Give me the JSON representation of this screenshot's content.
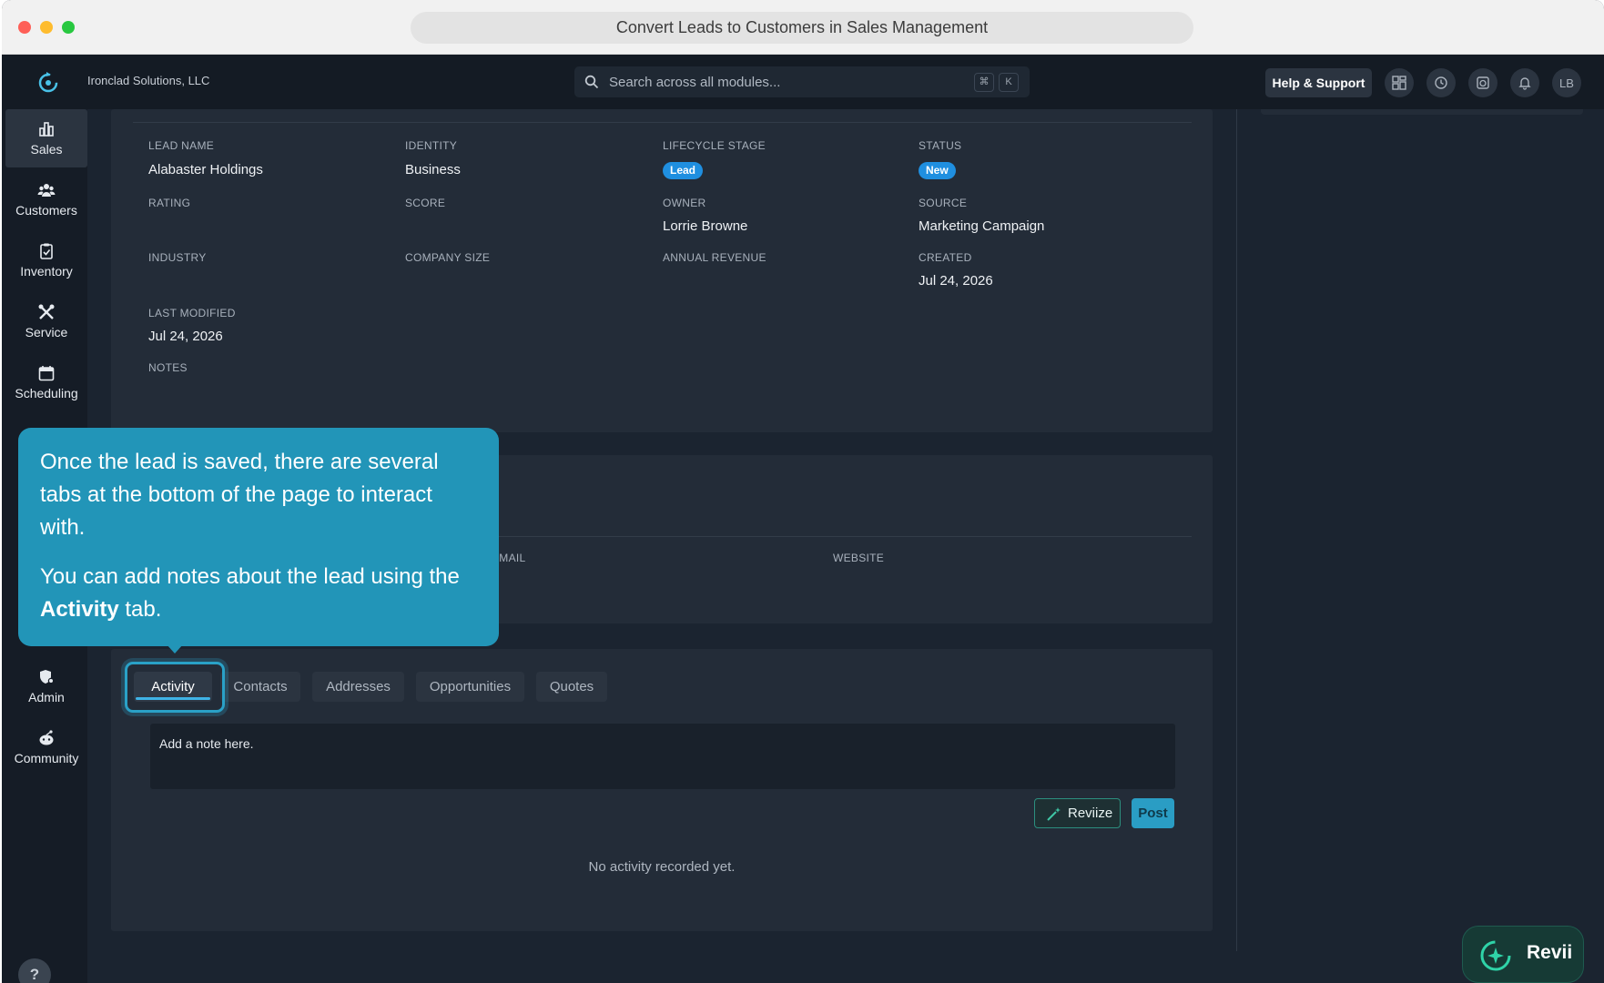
{
  "window": {
    "title": "Convert Leads to Customers in Sales Management"
  },
  "header": {
    "company": "Ironclad Solutions, LLC",
    "search_placeholder": "Search across all modules...",
    "kbd_cmd": "⌘",
    "kbd_k": "K",
    "help_label": "Help & Support",
    "avatar_initials": "LB",
    "icons": [
      "dashboard-icon",
      "history-icon",
      "timer-icon",
      "bell-icon"
    ]
  },
  "sidebar": {
    "items": [
      {
        "label": "Sales",
        "icon": "bar-chart-icon",
        "active": true
      },
      {
        "label": "Customers",
        "icon": "people-icon"
      },
      {
        "label": "Inventory",
        "icon": "clipboard-icon"
      },
      {
        "label": "Service",
        "icon": "tools-icon"
      },
      {
        "label": "Scheduling",
        "icon": "calendar-icon"
      },
      {
        "label": "Admin",
        "icon": "admin-gear-icon"
      },
      {
        "label": "Community",
        "icon": "community-icon"
      }
    ],
    "help_fab": "?"
  },
  "details": {
    "lead_name": {
      "label": "LEAD NAME",
      "value": "Alabaster Holdings"
    },
    "identity": {
      "label": "IDENTITY",
      "value": "Business"
    },
    "lifecycle_stage": {
      "label": "LIFECYCLE STAGE",
      "value": "Lead"
    },
    "status": {
      "label": "STATUS",
      "value": "New"
    },
    "rating": {
      "label": "RATING"
    },
    "score": {
      "label": "SCORE"
    },
    "owner": {
      "label": "OWNER",
      "value": "Lorrie Browne"
    },
    "source": {
      "label": "SOURCE",
      "value": "Marketing Campaign"
    },
    "industry": {
      "label": "INDUSTRY"
    },
    "company_size": {
      "label": "COMPANY SIZE"
    },
    "annual_revenue": {
      "label": "ANNUAL REVENUE"
    },
    "created": {
      "label": "CREATED",
      "value": "Jul 24, 2026"
    },
    "last_modified": {
      "label": "LAST MODIFIED",
      "value": "Jul 24, 2026"
    },
    "notes": {
      "label": "NOTES"
    }
  },
  "contact_card": {
    "email_label": "EMAIL",
    "website_label": "WEBSITE"
  },
  "tabs": [
    {
      "label": "Activity",
      "active": true
    },
    {
      "label": "Contacts"
    },
    {
      "label": "Addresses"
    },
    {
      "label": "Opportunities"
    },
    {
      "label": "Quotes"
    }
  ],
  "activity": {
    "note_text": "Add a note here.",
    "reviize_label": "Reviize",
    "post_label": "Post",
    "empty_message": "No activity recorded yet."
  },
  "tooltip": {
    "line1": "Once the lead is saved, there are several tabs at the bottom of the page to interact with.",
    "line2_pre": "You can add notes about the lead using the ",
    "line2_bold": "Activity",
    "line2_post": " tab."
  },
  "revii": {
    "label": "Revii"
  },
  "colors": {
    "accent": "#2295b8",
    "badge_blue": "#1f8fe0",
    "background": "#1b2430"
  }
}
